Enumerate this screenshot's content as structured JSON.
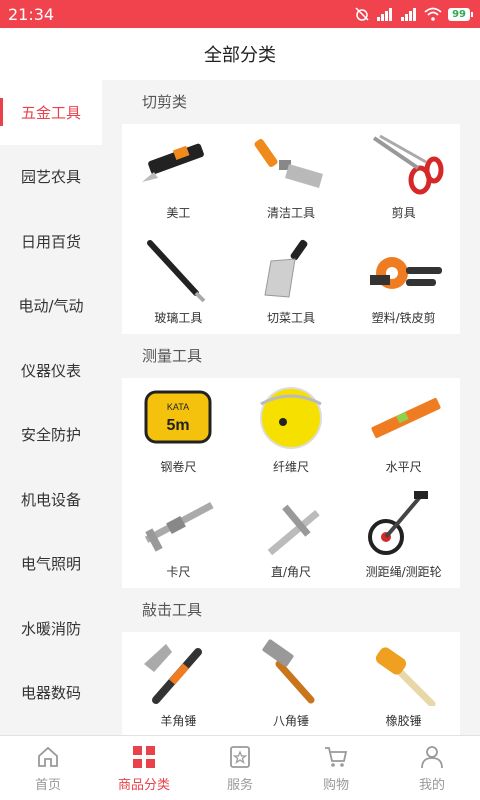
{
  "status": {
    "time": "21:34",
    "battery": "99"
  },
  "title": "全部分类",
  "sidebar": [
    "五金工具",
    "园艺农具",
    "日用百货",
    "电动/气动",
    "仪器仪表",
    "安全防护",
    "机电设备",
    "电气照明",
    "水暖消防",
    "电器数码"
  ],
  "sections": [
    {
      "title": "切剪类",
      "items": [
        "美工",
        "清洁工具",
        "剪具",
        "玻璃工具",
        "切菜工具",
        "塑料/铁皮剪"
      ]
    },
    {
      "title": "测量工具",
      "items": [
        "钢卷尺",
        "纤维尺",
        "水平尺",
        "卡尺",
        "直/角尺",
        "测距绳/测距轮"
      ]
    },
    {
      "title": "敲击工具",
      "items": [
        "羊角锤",
        "八角锤",
        "橡胶锤"
      ]
    }
  ],
  "product_icons": [
    [
      "utility-knife-icon",
      "scraper-icon",
      "scissors-icon",
      "glass-cutter-icon",
      "kitchen-knife-icon",
      "tin-snips-icon"
    ],
    [
      "tape-measure-icon",
      "fiber-tape-icon",
      "spirit-level-icon",
      "caliper-icon",
      "square-ruler-icon",
      "measuring-wheel-icon"
    ],
    [
      "claw-hammer-icon",
      "octagon-hammer-icon",
      "rubber-mallet-icon"
    ]
  ],
  "tape_label": {
    "brand": "KATA",
    "size": "5m"
  },
  "tabs": [
    "首页",
    "商品分类",
    "服务",
    "购物",
    "我的"
  ],
  "colors": {
    "accent": "#e9424b",
    "statusbar": "#f0434d"
  }
}
